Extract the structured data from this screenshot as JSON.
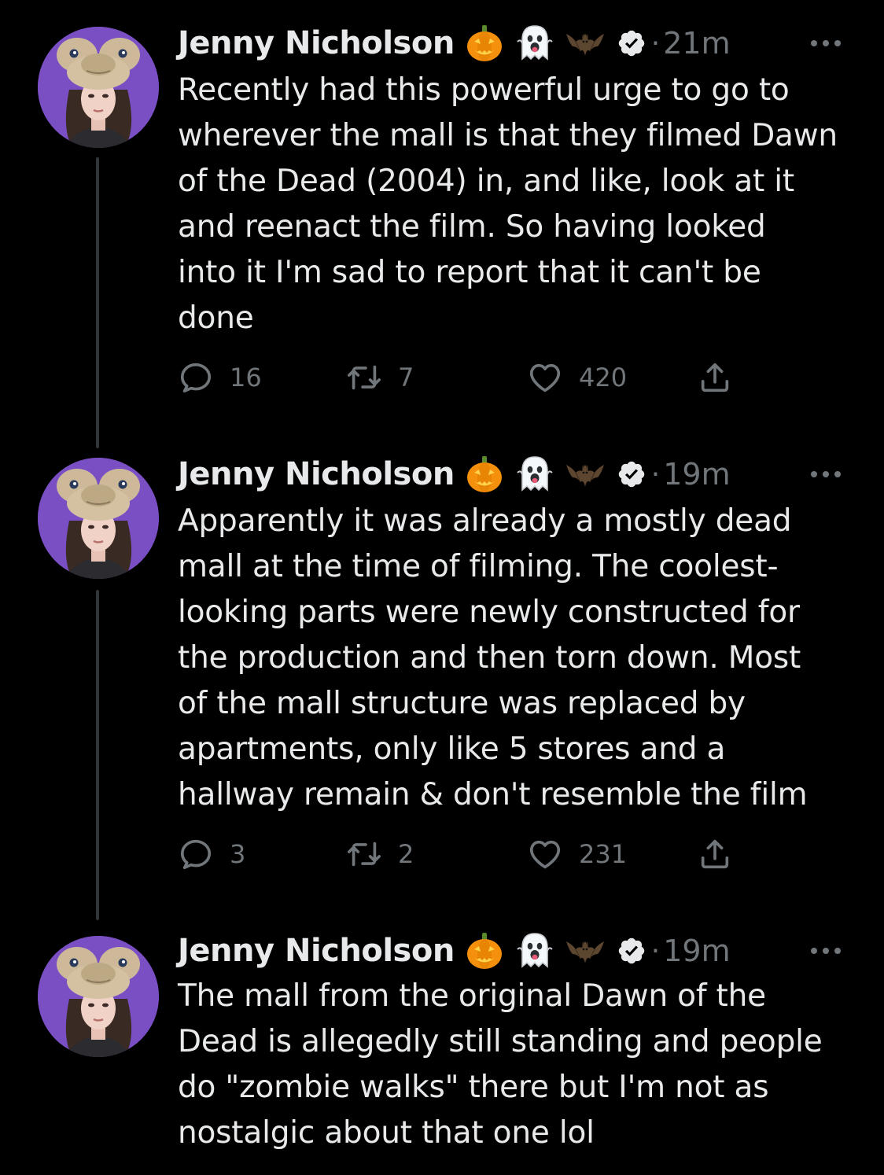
{
  "tweets": [
    {
      "author": "Jenny Nicholson",
      "emojis": [
        "jack-o-lantern-icon",
        "ghost-icon",
        "bat-icon"
      ],
      "separator": "·",
      "time": "21m",
      "text": "Recently had this powerful urge to go to\nwherever the mall is that they filmed Dawn\nof the Dead (2004) in, and like, look at it\nand reenact the film. So having looked\ninto it I'm sad to report that it can't be\ndone",
      "replies": "16",
      "retweets": "7",
      "likes": "420"
    },
    {
      "author": "Jenny Nicholson",
      "emojis": [
        "jack-o-lantern-icon",
        "ghost-icon",
        "bat-icon"
      ],
      "separator": "·",
      "time": "19m",
      "text": "Apparently it was already a mostly dead\nmall at the time of filming. The coolest-\nlooking parts were newly constructed for\nthe production and then torn down. Most\nof the mall structure was replaced by\napartments, only like 5 stores and a\nhallway remain & don't resemble the film",
      "replies": "3",
      "retweets": "2",
      "likes": "231"
    },
    {
      "author": "Jenny Nicholson",
      "emojis": [
        "jack-o-lantern-icon",
        "ghost-icon",
        "bat-icon"
      ],
      "separator": "·",
      "time": "19m",
      "text": "The mall from the original Dawn of the\nDead is allegedly still standing and people\ndo \"zombie walks\" there but I'm not as\nnostalgic about that one lol"
    }
  ],
  "colors": {
    "background": "#000000",
    "text": "#e7e9ea",
    "muted": "#71767b",
    "thread_line": "#333639",
    "avatar_bg": "#7b4fc4"
  }
}
